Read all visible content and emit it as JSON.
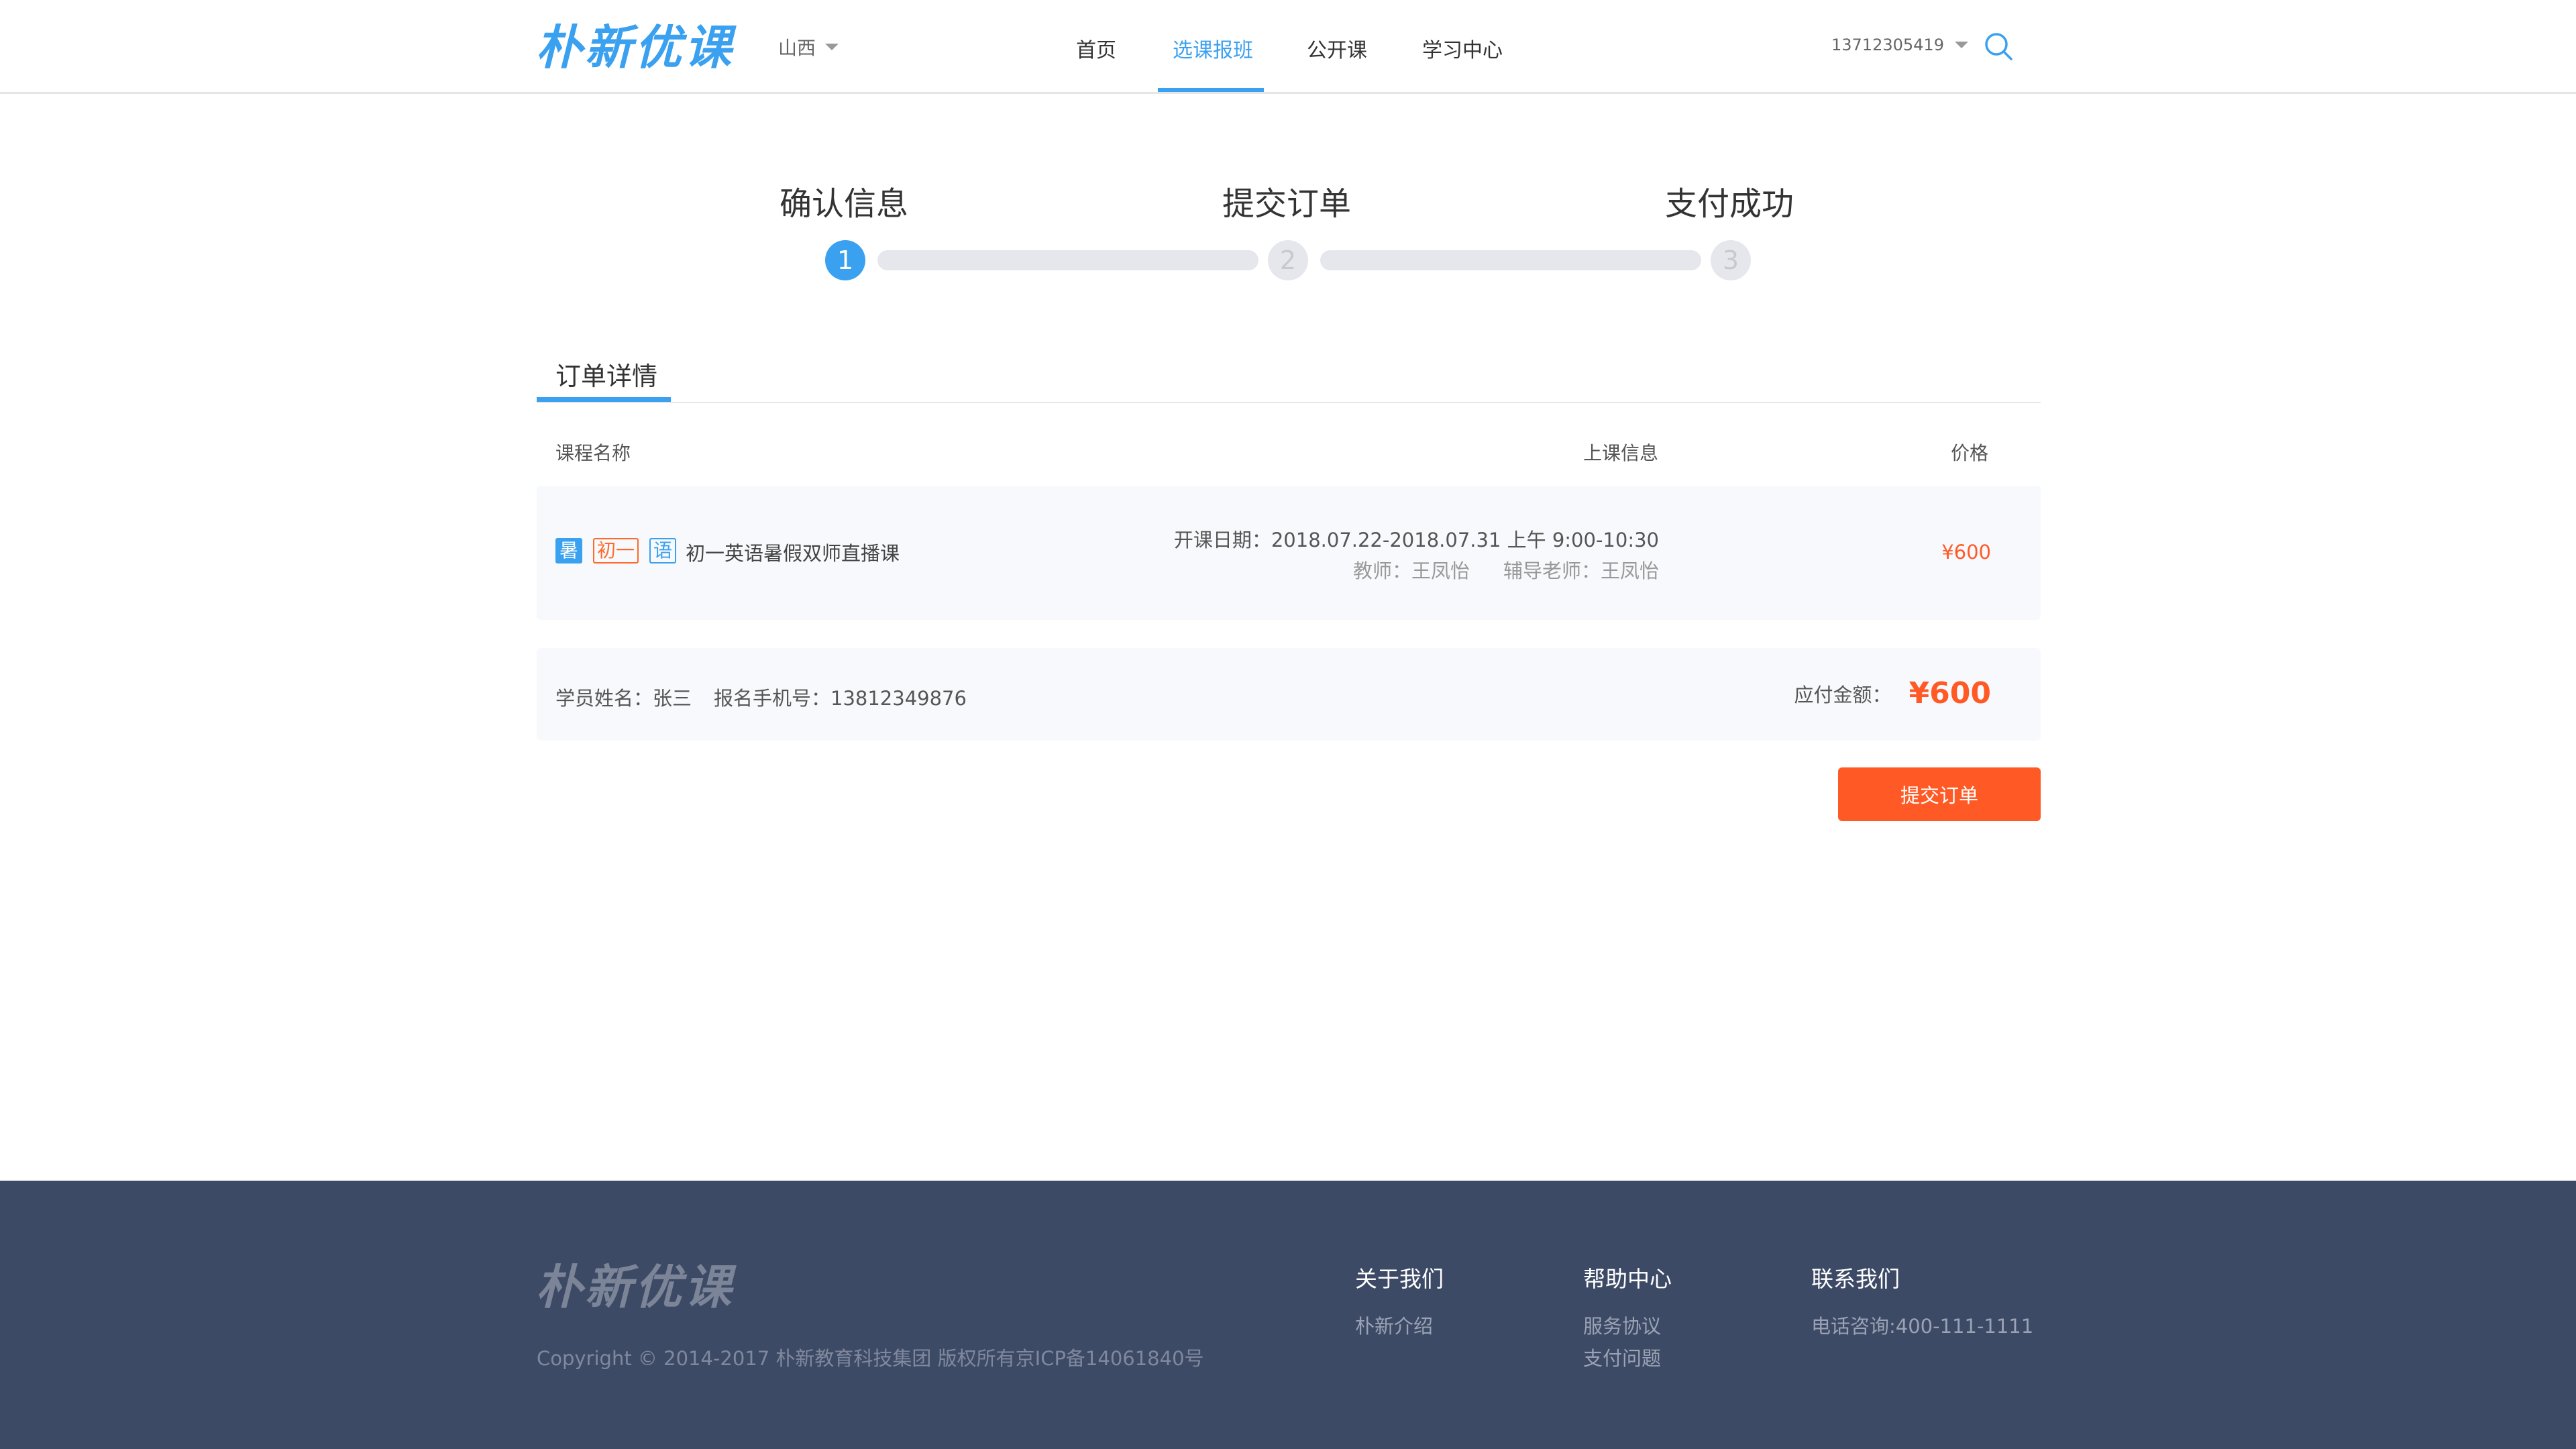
{
  "header": {
    "logo": "朴新优课",
    "region": "山西",
    "nav": [
      "首页",
      "选课报班",
      "公开课",
      "学习中心"
    ],
    "phone": "13712305419"
  },
  "steps": [
    "确认信息",
    "提交订单",
    "支付成功"
  ],
  "step_numbers": [
    "1",
    "2",
    "3"
  ],
  "order": {
    "tab": "订单详情",
    "columns": {
      "name": "课程名称",
      "info": "上课信息",
      "price": "价格"
    },
    "course": {
      "tags": [
        "暑",
        "初一",
        "语"
      ],
      "name": "初一英语暑假双师直播课",
      "schedule": "开课日期：2018.07.22-2018.07.31  上午 9:00-10:30",
      "teacher": "教师：王凤怡",
      "assistant": "辅导老师：王凤怡",
      "price": "¥600"
    },
    "student": "学员姓名：张三",
    "signup_phone": "报名手机号：13812349876",
    "pay_label": "应付金额：",
    "pay_amount": "¥600",
    "submit": "提交订单"
  },
  "footer": {
    "logo": "朴新优课",
    "copyright": "Copyright © 2014-2017 朴新教育科技集团 版权所有京ICP备14061840号",
    "columns": [
      {
        "title": "关于我们",
        "links": [
          "朴新介绍"
        ]
      },
      {
        "title": "帮助中心",
        "links": [
          "服务协议",
          "支付问题"
        ]
      },
      {
        "title": "联系我们",
        "links": [
          "电话咨询:400-111-1111"
        ]
      }
    ]
  },
  "colors": {
    "accent": "#3aa0f0",
    "orange": "#ff5a26",
    "footer_bg": "#3d4a66"
  },
  "icons": [
    "chevron-down-icon",
    "search-icon"
  ]
}
